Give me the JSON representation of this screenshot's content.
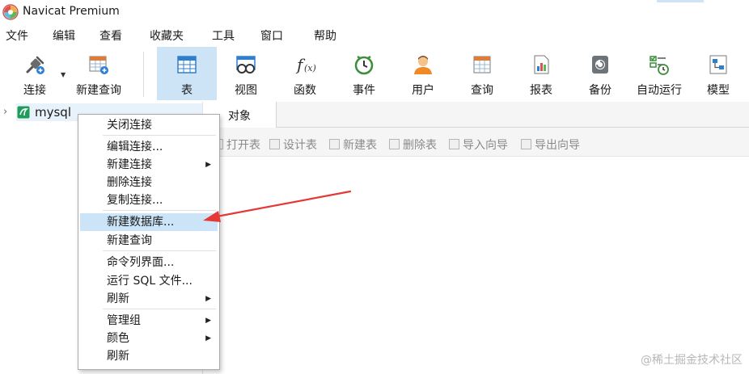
{
  "window": {
    "title": "Navicat Premium"
  },
  "menu": [
    "文件",
    "编辑",
    "查看",
    "收藏夹",
    "工具",
    "窗口",
    "帮助"
  ],
  "toolbar": {
    "connect": "连接",
    "new_query": "新建查询",
    "table": "表",
    "view": "视图",
    "function": "函数",
    "event": "事件",
    "user": "用户",
    "query": "查询",
    "report": "报表",
    "backup": "备份",
    "schedule": "自动运行",
    "model": "模型"
  },
  "navigator": {
    "connection_name": "mysql"
  },
  "objects": {
    "tab_label": "对象",
    "actions": [
      "打开表",
      "设计表",
      "新建表",
      "删除表",
      "导入向导",
      "导出向导"
    ]
  },
  "context_menu": {
    "close_connection": "关闭连接",
    "edit_connection": "编辑连接...",
    "new_connection": "新建连接",
    "delete_connection": "删除连接",
    "copy_connection": "复制连接...",
    "new_database": "新建数据库...",
    "new_query": "新建查询",
    "console": "命令列界面...",
    "run_sql_file": "运行 SQL 文件...",
    "refresh": "刷新",
    "manage_group": "管理组",
    "color": "颜色",
    "refresh_2": "刷新"
  },
  "watermark": "@稀土掘金技术社区",
  "colors": {
    "selected": "#cce4f7",
    "arrow": "#e53935",
    "accent": "#2f7fd0"
  }
}
